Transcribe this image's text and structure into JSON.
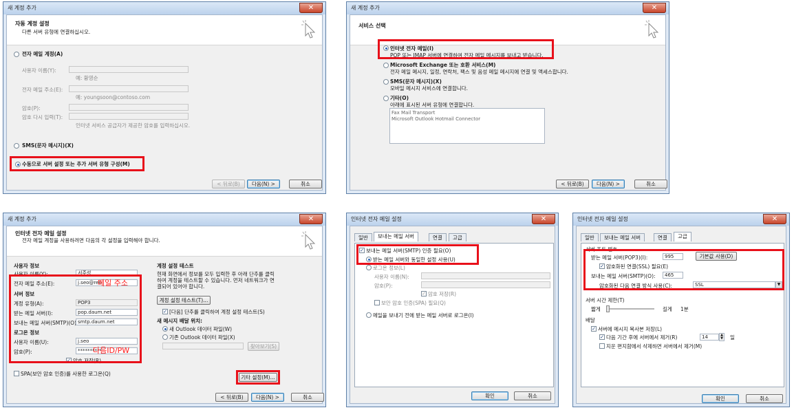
{
  "w1": {
    "title": "새 계정 추가",
    "header_title": "자동 계정 설정",
    "header_sub": "다른 서버 유형에 연결하십시오.",
    "opt_email": "전자 메일 계정(A)",
    "name_label": "사용자 이름(Y):",
    "name_hint": "예: 황영순",
    "email_label": "전자 메일 주소(E):",
    "email_hint": "예: youngsoon@contoso.com",
    "pw_label": "암호(P):",
    "pw2_label": "암호 다시 입력(T):",
    "pw_hint": "인터넷 서비스 공급자가 제공한 암호를 입력하십시오.",
    "opt_sms": "SMS(문자 메시지)(X)",
    "opt_manual": "수동으로 서버 설정 또는 추가 서버 유형 구성(M)",
    "back": "< 뒤로(B)",
    "next": "다음(N) >",
    "cancel": "취소"
  },
  "w2": {
    "title": "새 계정 추가",
    "header_title": "서비스 선택",
    "opt_internet": "인터넷 전자 메일(I)",
    "opt_internet_desc": "POP 또는 IMAP 서버에 연결하여 전자 메일 메시지를 보내고 받습니다.",
    "opt_exchange": "Microsoft Exchange 또는 호환 서비스(M)",
    "opt_exchange_desc": "전자 메일 메시지, 일정, 연락처, 팩스 및 음성 메일 메시지에 연결 및 액세스합니다.",
    "opt_sms": "SMS(문자 메시지)(X)",
    "opt_sms_desc": "모바일 메시지 서비스에 연결합니다.",
    "opt_other": "기타(O)",
    "opt_other_desc": "아래에 표시된 서버 유형에 연결합니다.",
    "list_items": [
      "Fax Mail Transport",
      "Microsoft Outlook Hotmail Connector"
    ],
    "back": "< 뒤로(B)",
    "next": "다음(N) >",
    "cancel": "취소"
  },
  "w3": {
    "title": "새 계정 추가",
    "header_title": "인터넷 전자 메일 설정",
    "header_sub": "전자 메일 계정을 사용하려면 다음의 각 설정을 입력해야 합니다.",
    "sec_user": "사용자 정보",
    "name_label": "사용자 이름(Y):",
    "name_value": "서주성",
    "email_label": "전자 메일 주소(E):",
    "email_value": "j.seo@ren",
    "sec_server": "서버 정보",
    "type_label": "계정 유형(A):",
    "type_value": "POP3",
    "in_label": "받는 메일 서버(I):",
    "in_value": "pop.daum.net",
    "out_label": "보내는 메일 서버(SMTP)(O):",
    "out_value": "smtp.daum.net",
    "sec_logon": "로그온 정보",
    "user_label": "사용자 이름(U):",
    "user_value": "j.seo",
    "pw_label": "암호(P):",
    "pw_value": "**********",
    "remember": "암호 저장(R)",
    "spa": "SPA(보안 암호 인증)를 사용한 로그온(Q)",
    "note_email": "메일 주소",
    "note_idpw": "다음ID/PW",
    "test_title": "계정 설정 테스트",
    "test_desc": [
      "현재 화면에서 정보를 모두 입력한 후 아래 단추를 클릭",
      "하여 계정을 테스트할 수 있습니다. 먼저 네트워크가 연",
      "결되어 있어야 합니다."
    ],
    "test_button": "계정 설정 테스트(T)...",
    "test_auto": "[다음] 단추를 클릭하여 계정 설정 테스트(S)",
    "deliver_title": "새 메시지 배달 위치:",
    "deliver_new": "새 Outlook 데이터 파일(W)",
    "deliver_existing": "기존 Outlook 데이터 파일(X)",
    "browse": "찾아보기(S)",
    "more": "기타 설정(M)...",
    "back": "< 뒤로(B)",
    "next": "다음(N) >",
    "cancel": "취소"
  },
  "w4": {
    "title": "인터넷 전자 메일 설정",
    "tabs": [
      "일반",
      "보내는 메일 서버",
      "연결",
      "고급"
    ],
    "auth": "보내는 메일 서버(SMTP) 인증 필요(O)",
    "same": "받는 메일 서버와 동일한 설정 사용(U)",
    "logon": "로그온 정보(L)",
    "user_label": "사용자 이름(N):",
    "pw_label": "암호(P):",
    "remember": "암호 저장(R)",
    "spa": "보안 암호 인증(SPA) 필요(Q)",
    "before": "메일을 보내기 전에 받는 메일 서버로 로그온(I)",
    "ok": "확인",
    "cancel": "취소"
  },
  "w5": {
    "title": "인터넷 전자 메일 설정",
    "tabs": [
      "일반",
      "보내는 메일 서버",
      "연결",
      "고급"
    ],
    "port_title": "서버 포트 번호",
    "in_label": "받는 메일 서버(POP3)(I):",
    "in_value": "995",
    "default_btn": "기본값 사용(D)",
    "ssl": "암호화된 연결(SSL) 필요(E)",
    "out_label": "보내는 메일 서버(SMTP)(O):",
    "out_value": "465",
    "enc_label": "암호화된 다음 연결 방식 사용(C):",
    "enc_value": "SSL",
    "timeout_title": "서버 시간 제한(T)",
    "short": "짧게",
    "long": "길게",
    "timeout_value": "1분",
    "delivery_title": "배달",
    "leave": "서버에 메시지 복사본 저장(L)",
    "remove": "다음 기간 후에 서버에서 제거(R)",
    "days_value": "14",
    "days_unit": "일",
    "deleted": "지운 편지함에서 삭제하면 서버에서 제거(M)",
    "ok": "확인",
    "cancel": "취소"
  },
  "colors": {
    "highlight": "#e8101a",
    "note": "#ff1a1a"
  }
}
